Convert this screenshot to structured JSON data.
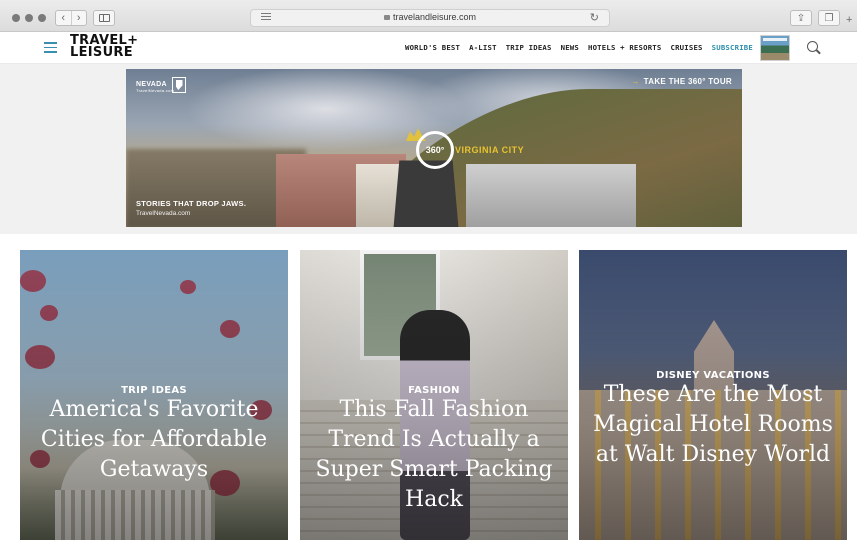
{
  "browser": {
    "back": "‹",
    "forward": "›",
    "url": "travelandleisure.com",
    "reload": "↻",
    "share": "⇪",
    "tabs": "❐",
    "newtab": "+"
  },
  "site": {
    "logo_line1": "TRAVEL+",
    "logo_line2": "LEISURE",
    "nav": [
      {
        "label": "WORLD'S BEST"
      },
      {
        "label": "A-LIST"
      },
      {
        "label": "TRIP IDEAS"
      },
      {
        "label": "NEWS"
      },
      {
        "label": "HOTELS + RESORTS"
      },
      {
        "label": "CRUISES"
      },
      {
        "label": "SUBSCRIBE"
      }
    ],
    "accent_color": "#2f8fae"
  },
  "ad": {
    "brand": "NEVADA",
    "brand_sub": "TravelNevada.com",
    "tour": "TAKE THE 360° TOUR",
    "badge": "360°",
    "city": "VIRGINIA CITY",
    "tagline": "STORIES THAT DROP JAWS.",
    "site": "TravelNevada.com"
  },
  "cards": [
    {
      "kicker": "TRIP IDEAS",
      "headline": "America's Favorite Cities for Affordable Getaways"
    },
    {
      "kicker": "FASHION",
      "headline": "This Fall Fashion Trend Is Actually a Super Smart Packing Hack"
    },
    {
      "kicker": "DISNEY VACATIONS",
      "headline": "These Are the Most Magical Hotel Rooms at Walt Disney World"
    }
  ]
}
